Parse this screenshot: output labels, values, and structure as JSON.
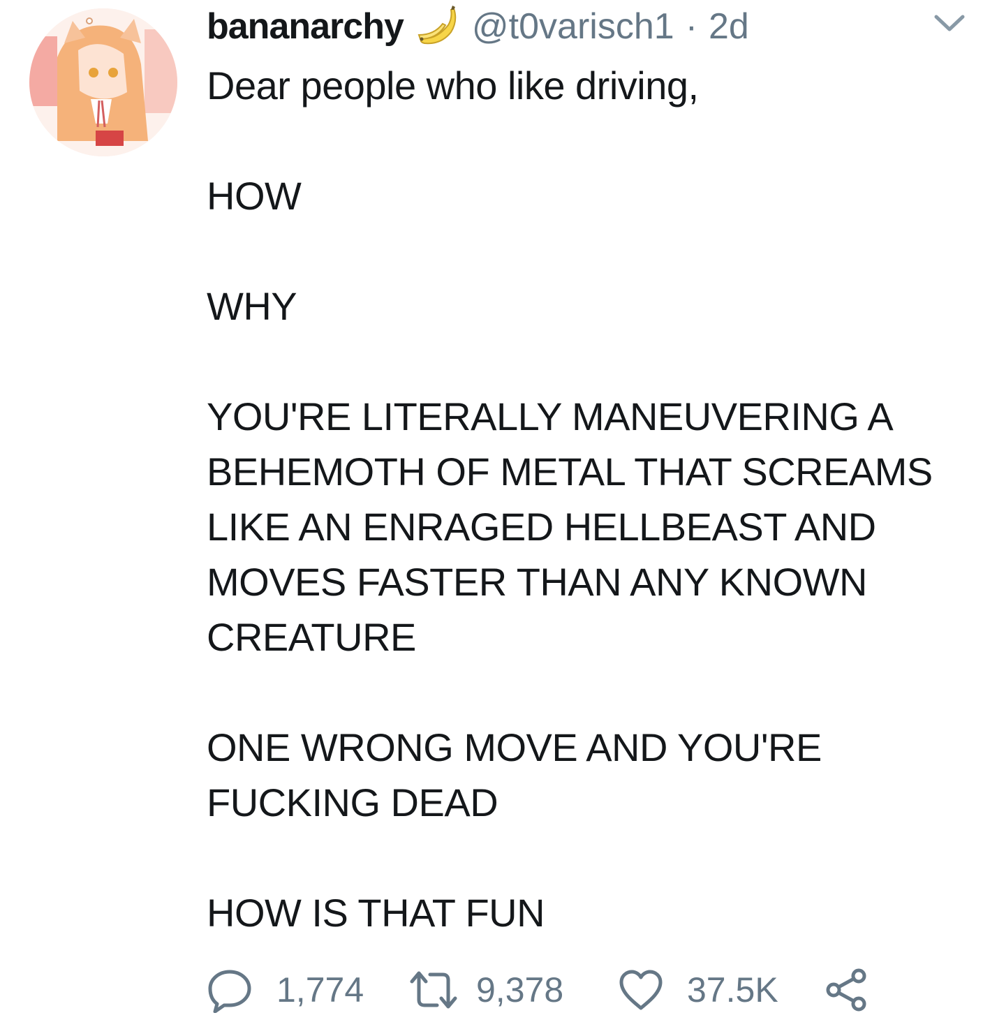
{
  "tweet": {
    "display_name": "bananarchy",
    "emoji_icon": "banana-icon",
    "handle": "@t0varisch1",
    "separator": "·",
    "time": "2d",
    "menu_icon": "chevron-down-icon",
    "lines": [
      "Dear people who like driving,",
      "",
      "HOW",
      "",
      "WHY",
      "",
      "YOU'RE LITERALLY MANEUVERING A",
      "BEHEMOTH OF METAL THAT SCREAMS",
      "LIKE AN ENRAGED HELLBEAST AND",
      "MOVES FASTER THAN ANY KNOWN",
      "CREATURE",
      "",
      "ONE WRONG MOVE AND YOU'RE",
      "FUCKING DEAD",
      "",
      "HOW IS THAT FUN"
    ]
  },
  "actions": {
    "reply": {
      "icon": "reply-icon",
      "count": "1,774"
    },
    "retweet": {
      "icon": "retweet-icon",
      "count": "9,378"
    },
    "like": {
      "icon": "heart-icon",
      "count": "37.5K"
    },
    "share": {
      "icon": "share-icon"
    }
  },
  "colors": {
    "text": "#14171a",
    "secondary": "#657786"
  }
}
